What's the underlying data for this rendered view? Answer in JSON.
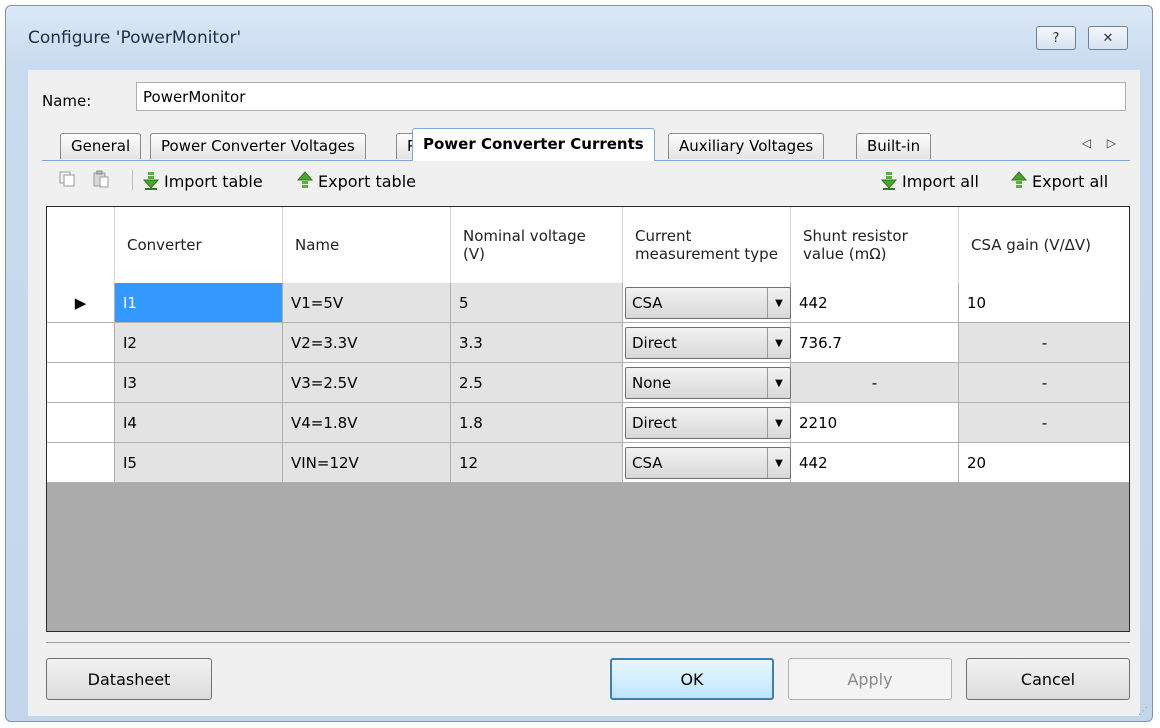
{
  "window": {
    "title": "Configure 'PowerMonitor'",
    "help_label": "?",
    "close_label": "✕"
  },
  "name_field": {
    "label": "Name:",
    "value": "PowerMonitor"
  },
  "tabs": [
    {
      "label": "General",
      "active": false
    },
    {
      "label": "Power Converter Voltages",
      "active": false
    },
    {
      "label": "Power Converter Currents",
      "active": true
    },
    {
      "label": "Auxiliary Voltages",
      "active": false
    },
    {
      "label": "Built-in",
      "active": false
    }
  ],
  "tab_scroll_label": "◁ ▷",
  "toolbar": {
    "copy_icon": "copy-icon",
    "paste_icon": "paste-icon",
    "import_table_label": "Import table",
    "export_table_label": "Export table",
    "import_all_label": "Import all",
    "export_all_label": "Export all"
  },
  "table": {
    "columns": [
      "Converter",
      "Name",
      "Nominal voltage (V)",
      "Current measurement type",
      "Shunt resistor value (mΩ)",
      "CSA gain (V/ΔV)"
    ],
    "rows": [
      {
        "converter": "I1",
        "name": "V1=5V",
        "nominal": "5",
        "type": "CSA",
        "shunt": "442",
        "gain": "10",
        "current": true
      },
      {
        "converter": "I2",
        "name": "V2=3.3V",
        "nominal": "3.3",
        "type": "Direct",
        "shunt": "736.7",
        "gain": "-",
        "current": false
      },
      {
        "converter": "I3",
        "name": "V3=2.5V",
        "nominal": "2.5",
        "type": "None",
        "shunt": "-",
        "gain": "-",
        "current": false
      },
      {
        "converter": "I4",
        "name": "V4=1.8V",
        "nominal": "1.8",
        "type": "Direct",
        "shunt": "2210",
        "gain": "-",
        "current": false
      },
      {
        "converter": "I5",
        "name": "VIN=12V",
        "nominal": "12",
        "type": "CSA",
        "shunt": "442",
        "gain": "20",
        "current": false
      }
    ],
    "row_indicator": "▶"
  },
  "buttons": {
    "datasheet": "Datasheet",
    "ok": "OK",
    "apply": "Apply",
    "cancel": "Cancel"
  },
  "colors": {
    "selection": "#3399ff",
    "tab_accent": "#7fa6d6"
  }
}
